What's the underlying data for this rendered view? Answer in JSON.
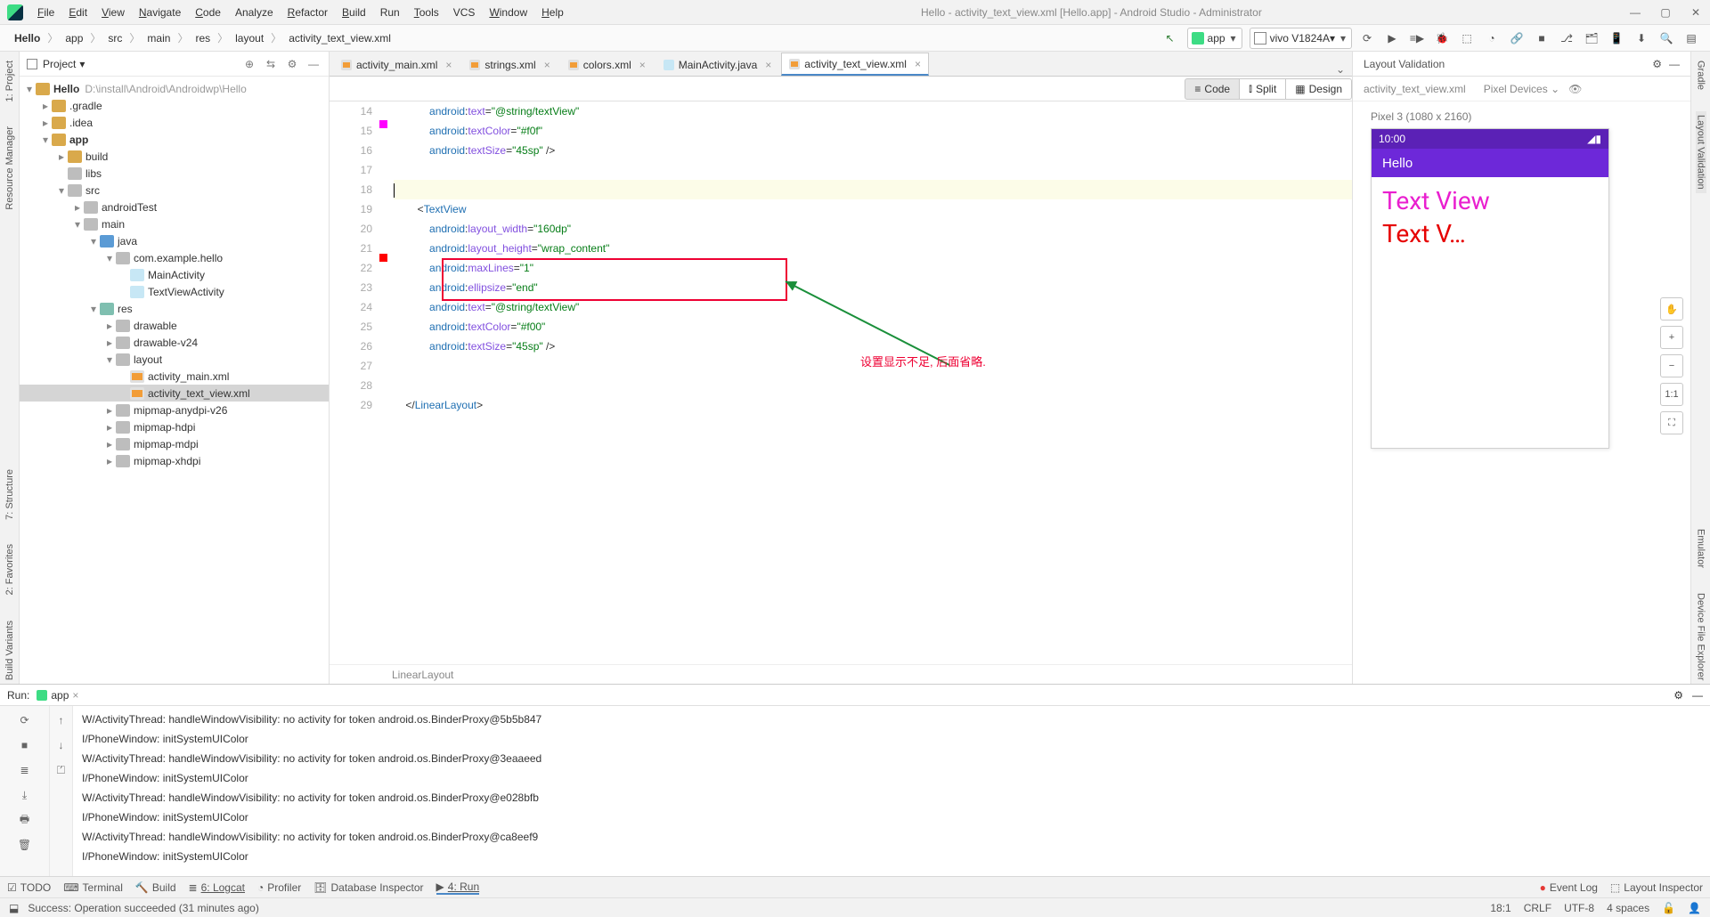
{
  "window": {
    "title": "Hello - activity_text_view.xml [Hello.app] - Android Studio - Administrator"
  },
  "menu": {
    "file": "File",
    "edit": "Edit",
    "view": "View",
    "navigate": "Navigate",
    "code": "Code",
    "analyze": "Analyze",
    "refactor": "Refactor",
    "build": "Build",
    "run": "Run",
    "tools": "Tools",
    "vcs": "VCS",
    "window": "Window",
    "help": "Help"
  },
  "breadcrumbs": [
    "Hello",
    "app",
    "src",
    "main",
    "res",
    "layout",
    "activity_text_view.xml"
  ],
  "toolbar": {
    "config": "app",
    "device": "vivo V1824A"
  },
  "leftTabs": [
    "1: Project",
    "Resource Manager"
  ],
  "rightTabs": [
    "Gradle",
    "Layout Validation",
    "Emulator",
    "Device File Explorer"
  ],
  "projectPane": {
    "selector": "Project",
    "root": {
      "name": "Hello",
      "path": "D:\\install\\Android\\Androidwp\\Hello"
    },
    "nodes": [
      ".gradle",
      ".idea",
      "app",
      "build",
      "libs",
      "src",
      "androidTest",
      "main",
      "java",
      "com.example.hello",
      "MainActivity",
      "TextViewActivity",
      "res",
      "drawable",
      "drawable-v24",
      "layout",
      "activity_main.xml",
      "activity_text_view.xml",
      "mipmap-anydpi-v26",
      "mipmap-hdpi",
      "mipmap-mdpi",
      "mipmap-xhdpi"
    ]
  },
  "tabs": [
    {
      "label": "activity_main.xml",
      "icon": "xml"
    },
    {
      "label": "strings.xml",
      "icon": "xml"
    },
    {
      "label": "colors.xml",
      "icon": "xml"
    },
    {
      "label": "MainActivity.java",
      "icon": "cls"
    },
    {
      "label": "activity_text_view.xml",
      "icon": "xml",
      "active": true
    }
  ],
  "viewModes": {
    "code": "Code",
    "split": "Split",
    "design": "Design"
  },
  "codeLines": {
    "start": 14,
    "lines": [
      {
        "n": 14,
        "t": "            android:text=\"@string/textView\"",
        "ns": true
      },
      {
        "n": 15,
        "t": "            android:textColor=\"#f0f\"",
        "mark": "#f0f",
        "ns": true
      },
      {
        "n": 16,
        "t": "            android:textSize=\"45sp\" />",
        "ns": true
      },
      {
        "n": 17,
        "t": ""
      },
      {
        "n": 18,
        "t": "",
        "hl": true,
        "cursor": true
      },
      {
        "n": 19,
        "t": "        <TextView"
      },
      {
        "n": 20,
        "t": "            android:layout_width=\"160dp\"",
        "ns": true
      },
      {
        "n": 21,
        "t": "            android:layout_height=\"wrap_content\"",
        "ns": true
      },
      {
        "n": 22,
        "t": "            android:maxLines=\"1\"",
        "ns": true
      },
      {
        "n": 23,
        "t": "            android:ellipsize=\"end\"",
        "ns": true
      },
      {
        "n": 24,
        "t": "            android:text=\"@string/textView\"",
        "ns": true
      },
      {
        "n": 25,
        "t": "            android:textColor=\"#f00\"",
        "mark": "#f00",
        "ns": true
      },
      {
        "n": 26,
        "t": "            android:textSize=\"45sp\" />",
        "ns": true
      },
      {
        "n": 27,
        "t": ""
      },
      {
        "n": 28,
        "t": ""
      },
      {
        "n": 29,
        "t": "    </LinearLayout>"
      }
    ]
  },
  "codeCrumb": "LinearLayout",
  "annotation": "设置显示不足, 后面省略.",
  "validation": {
    "title": "Layout Validation",
    "file": "activity_text_view.xml",
    "devicesLabel": "Pixel Devices",
    "deviceName": "Pixel 3 (1080 x 2160)",
    "statusTime": "10:00",
    "appName": "Hello",
    "tv1": "Text View",
    "tv2": "Text V…",
    "zoom": [
      "✋",
      "+",
      "−",
      "1:1",
      "⛶"
    ]
  },
  "run": {
    "label": "Run:",
    "app": "app",
    "lines": [
      "W/ActivityThread: handleWindowVisibility: no activity for token android.os.BinderProxy@5b5b847",
      "I/PhoneWindow: initSystemUIColor",
      "W/ActivityThread: handleWindowVisibility: no activity for token android.os.BinderProxy@3eaaeed",
      "I/PhoneWindow: initSystemUIColor",
      "W/ActivityThread: handleWindowVisibility: no activity for token android.os.BinderProxy@e028bfb",
      "I/PhoneWindow: initSystemUIColor",
      "W/ActivityThread: handleWindowVisibility: no activity for token android.os.BinderProxy@ca8eef9",
      "I/PhoneWindow: initSystemUIColor"
    ]
  },
  "bottomBar": {
    "todo": "TODO",
    "terminal": "Terminal",
    "build": "Build",
    "logcat": "6: Logcat",
    "profiler": "Profiler",
    "db": "Database Inspector",
    "run": "4: Run",
    "eventlog": "Event Log",
    "layoutinsp": "Layout Inspector"
  },
  "status": {
    "msg": "Success: Operation succeeded (31 minutes ago)",
    "pos": "18:1",
    "eol": "CRLF",
    "enc": "UTF-8",
    "indent": "4 spaces"
  }
}
